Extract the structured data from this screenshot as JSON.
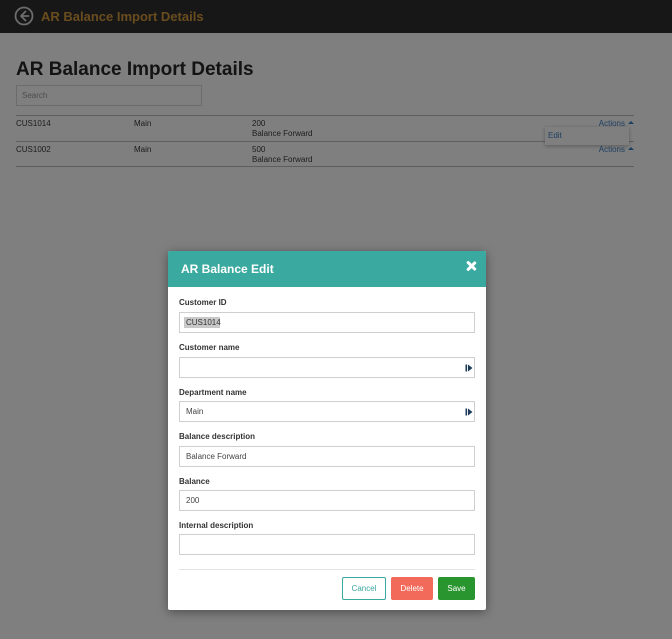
{
  "topbar": {
    "title": "AR Balance Import Details"
  },
  "page": {
    "title": "AR Balance Import Details",
    "search_placeholder": "Search",
    "rows": [
      {
        "customer_id": "CUS1014",
        "department": "Main",
        "balance": "200",
        "description": "Balance Forward",
        "actions": "Actions"
      },
      {
        "customer_id": "CUS1002",
        "department": "Main",
        "balance": "500",
        "description": "Balance Forward",
        "actions": "Actions"
      }
    ],
    "dropdown": {
      "edit_label": "Edit"
    }
  },
  "modal": {
    "title": "AR Balance Edit",
    "fields": {
      "customer_id": {
        "label": "Customer ID",
        "value": "CUS1014"
      },
      "customer_name": {
        "label": "Customer name",
        "value": ""
      },
      "department_name": {
        "label": "Department name",
        "value": "Main"
      },
      "balance_description": {
        "label": "Balance description",
        "value": "Balance Forward"
      },
      "balance": {
        "label": "Balance",
        "value": "200"
      },
      "internal_description": {
        "label": "Internal description",
        "value": ""
      }
    },
    "buttons": {
      "cancel": "Cancel",
      "delete": "Delete",
      "save": "Save"
    }
  },
  "colors": {
    "topbar": "#2e2e2e",
    "topbar_title": "#d49a3d",
    "modal_header": "#3aa99f",
    "link": "#3b7fc4",
    "delete": "#f26a5a",
    "save": "#28952e"
  },
  "icons": {
    "back": "back-arrow-icon",
    "close": "close-icon",
    "picker": "picker-icon"
  }
}
